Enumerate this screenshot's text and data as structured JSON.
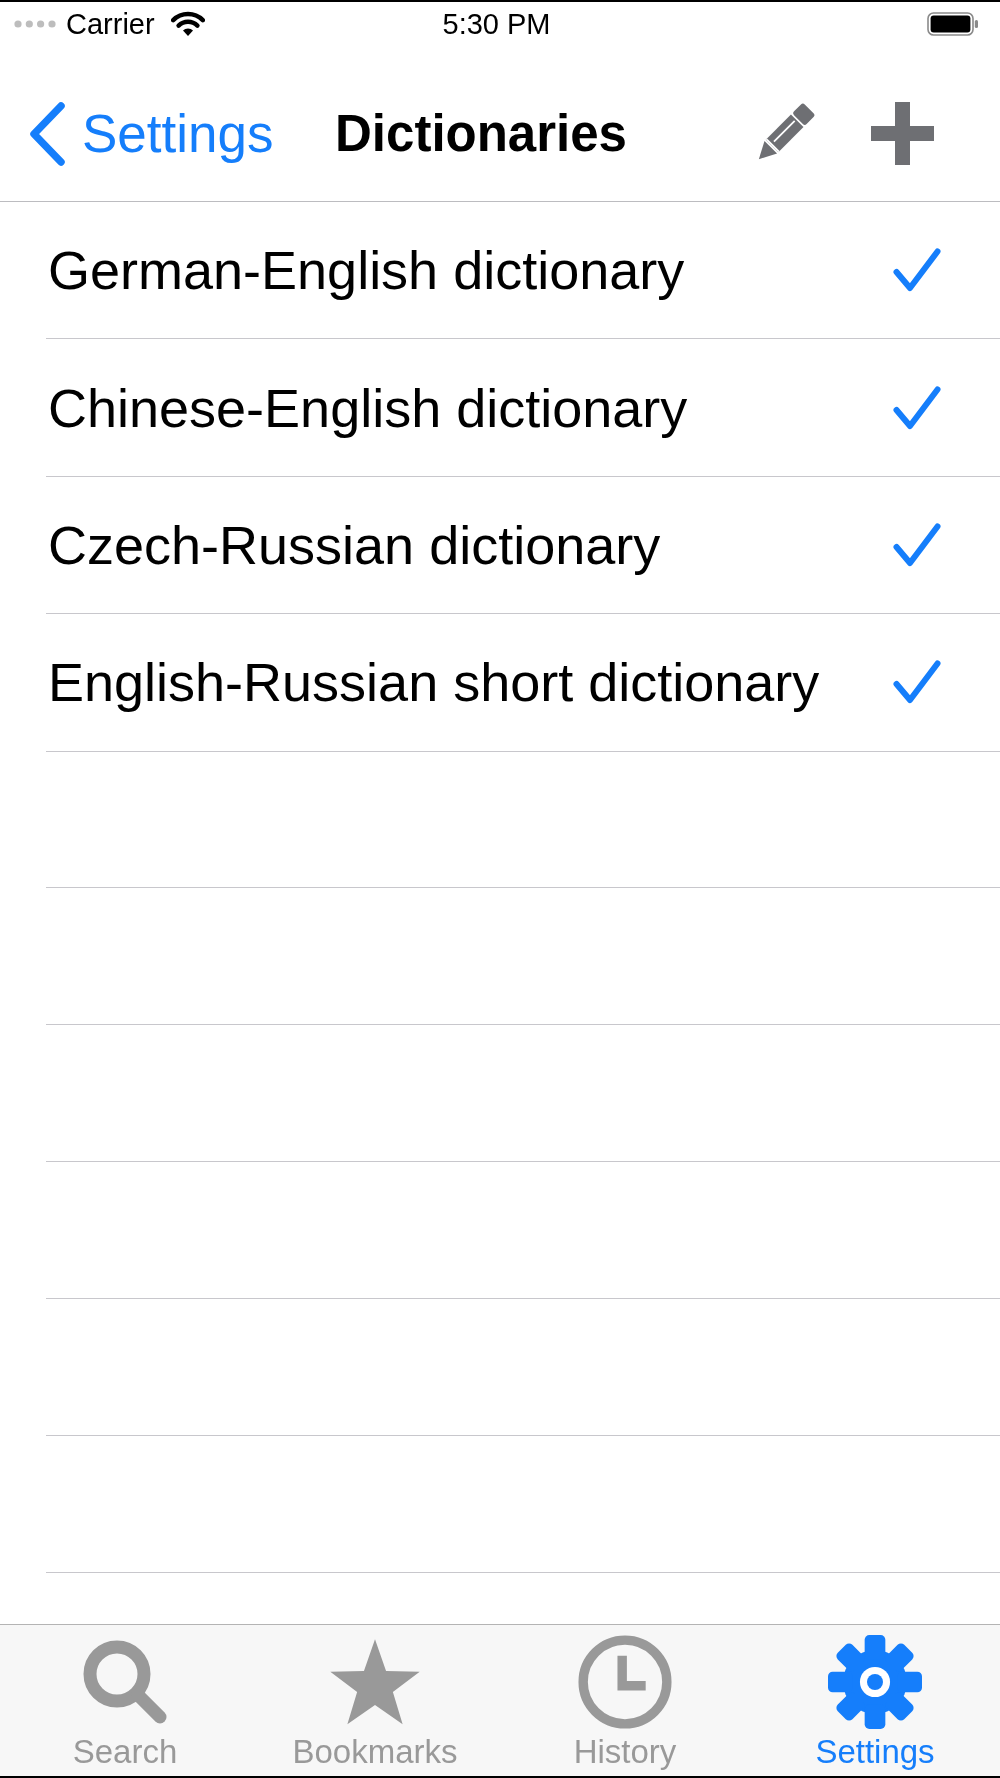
{
  "status_bar": {
    "carrier": "Carrier",
    "time": "5:30 PM"
  },
  "nav_bar": {
    "back": "Settings",
    "title": "Dictionaries"
  },
  "dictionaries": [
    {
      "name": "German-English dictionary",
      "checked": true
    },
    {
      "name": "Chinese-English dictionary",
      "checked": true
    },
    {
      "name": "Czech-Russian dictionary",
      "checked": true
    },
    {
      "name": "English-Russian short dictionary",
      "checked": true
    }
  ],
  "tab_bar": {
    "tabs": [
      {
        "label": "Search",
        "selected": false
      },
      {
        "label": "Bookmarks",
        "selected": false
      },
      {
        "label": "History",
        "selected": false
      },
      {
        "label": "Settings",
        "selected": true
      }
    ]
  }
}
